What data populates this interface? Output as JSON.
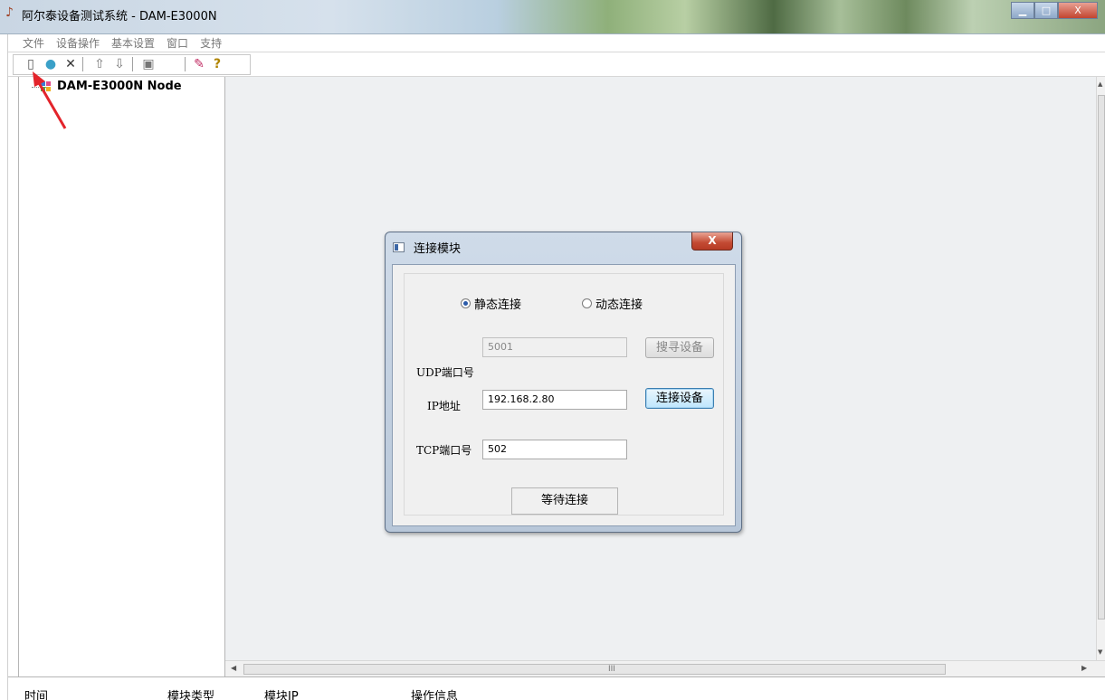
{
  "window": {
    "title": "阿尔泰设备测试系统 - DAM-E3000N",
    "buttons": {
      "minimize": "▁",
      "maximize": "□",
      "close": "X"
    }
  },
  "menu": [
    "文件",
    "设备操作",
    "基本设置",
    "窗口",
    "支持"
  ],
  "toolbar": {
    "buttons": [
      {
        "name": "connect-icon",
        "glyph": "▯"
      },
      {
        "name": "refresh-icon",
        "glyph": "●"
      },
      {
        "name": "disconnect-icon",
        "glyph": "✕"
      },
      {
        "name": "upload-icon",
        "glyph": "⇧"
      },
      {
        "name": "download-icon",
        "glyph": "⇩"
      },
      {
        "name": "config-icon",
        "glyph": "▣"
      },
      {
        "name": "tool-icon",
        "glyph": "✎"
      },
      {
        "name": "help-icon",
        "glyph": "?"
      }
    ]
  },
  "tree": {
    "node_label": "DAM-E3000N Node"
  },
  "dialog": {
    "title": "连接模块",
    "close": "X",
    "radio_static": "静态连接",
    "radio_dynamic": "动态连接",
    "selected": "static",
    "udp_label_prefix": "UDP",
    "udp_label_suffix": "端口号",
    "udp_value": "5001",
    "search_button": "搜寻设备",
    "ip_label_prefix": "IP",
    "ip_label_suffix": "地址",
    "ip_value": "192.168.2.80",
    "connect_button": "连接设备",
    "tcp_label_prefix": "TCP",
    "tcp_label_suffix": "端口号",
    "tcp_value": "502",
    "status": "等待连接"
  },
  "scroll": {
    "grip": "III"
  },
  "status_columns": [
    "时间",
    "模块类型",
    "模块IP",
    "操作信息"
  ],
  "colors": {
    "annotation_arrow": "#e3242b",
    "accent": "#3c7fb1"
  }
}
